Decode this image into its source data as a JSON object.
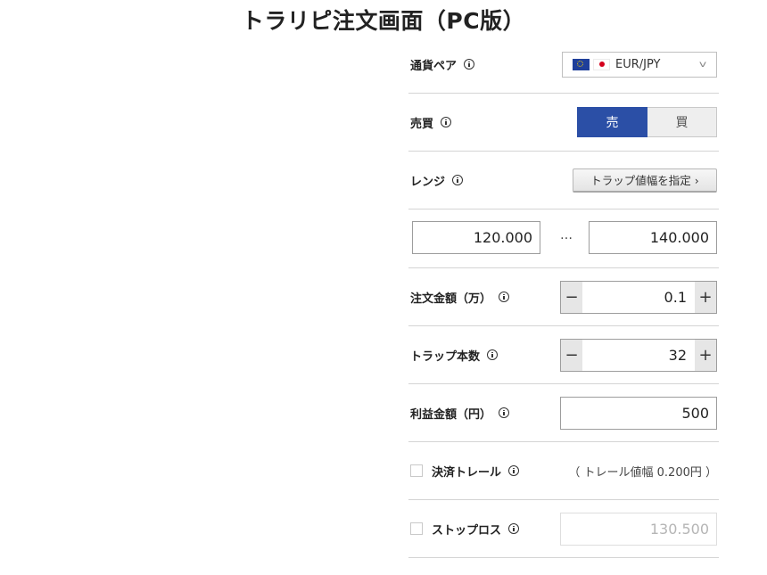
{
  "title": "トラリピ注文画面（PC版）",
  "pair": {
    "label": "通貨ペア",
    "value": "EUR/JPY"
  },
  "side": {
    "label": "売買",
    "sell": "売",
    "buy": "買",
    "selected": "sell"
  },
  "range": {
    "label": "レンジ",
    "button": "トラップ値幅を指定 ›",
    "low": "120.000",
    "sep": "…",
    "high": "140.000"
  },
  "amount": {
    "label": "注文金額（万）",
    "value": "0.1",
    "minus": "−",
    "plus": "+"
  },
  "traps": {
    "label": "トラップ本数",
    "value": "32",
    "minus": "−",
    "plus": "+"
  },
  "profit": {
    "label": "利益金額（円）",
    "value": "500"
  },
  "trail": {
    "label": "決済トレール",
    "note": "（ トレール値幅 0.200円 ）"
  },
  "stoploss": {
    "label": "ストップロス",
    "placeholder": "130.500"
  },
  "colors": {
    "accent": "#2b4fa6",
    "border": "#9d9d9d"
  }
}
